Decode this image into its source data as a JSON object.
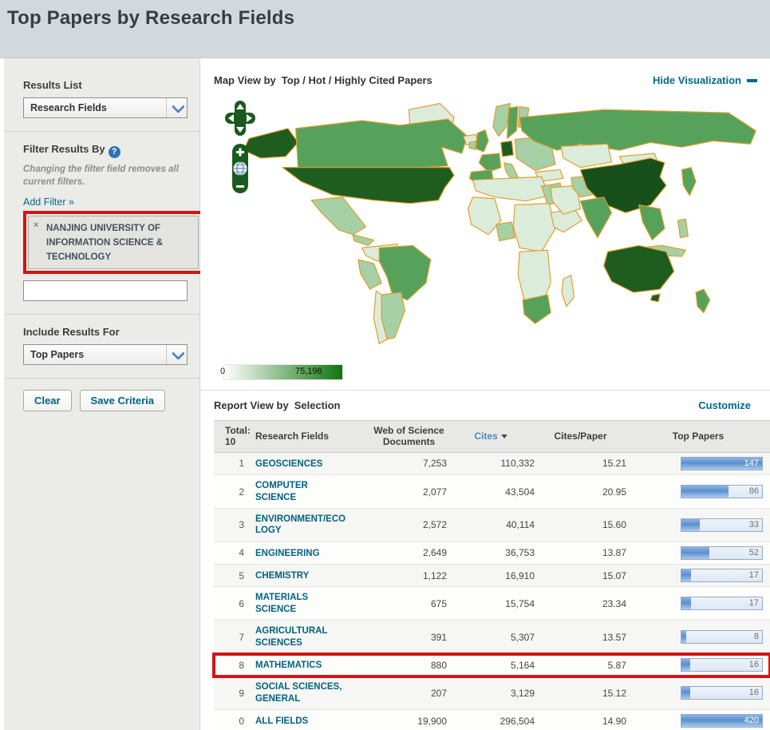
{
  "theme": {
    "header_bg": "#d2d9dd",
    "teal_link": "#00698c",
    "field_link": "#00637f",
    "sort_blue": "#4d86c4",
    "annotation_red": "#d21414"
  },
  "page": {
    "title": "Top Papers by Research Fields"
  },
  "sidebar": {
    "results_list": {
      "label": "Results List",
      "value": "Research Fields"
    },
    "filter": {
      "label": "Filter Results By",
      "note": "Changing the filter field removes all current filters.",
      "add_filter_link": "Add Filter »",
      "chip": {
        "remove": "×",
        "text": "NANJING UNIVERSITY OF INFORMATION SCIENCE & TECHNOLOGY"
      },
      "input_value": ""
    },
    "include_results": {
      "label": "Include Results For",
      "value": "Top Papers"
    },
    "buttons": {
      "clear": "Clear",
      "save": "Save Criteria"
    }
  },
  "map_section": {
    "title_prefix": "Map View by",
    "title": "Top / Hot / Highly Cited Papers",
    "hide_link": "Hide Visualization",
    "legend": {
      "min": "0",
      "max": "75,196"
    },
    "colors": {
      "dark": "#1e5c20",
      "darker": "#17501a",
      "medium": "#57a25b",
      "light": "#a6d0a6",
      "pale": "#dcecdb",
      "border": "#e29c2a",
      "legend_end": "#0f750f",
      "controls": "#1a5a1e"
    },
    "regions": [
      {
        "name": "alaska",
        "tone": "dark"
      },
      {
        "name": "canada",
        "tone": "medium"
      },
      {
        "name": "greenland",
        "tone": "pale"
      },
      {
        "name": "usa",
        "tone": "dark"
      },
      {
        "name": "mexico",
        "tone": "light"
      },
      {
        "name": "central-america",
        "tone": "light"
      },
      {
        "name": "colombia-venezuela",
        "tone": "pale"
      },
      {
        "name": "peru",
        "tone": "light"
      },
      {
        "name": "brazil",
        "tone": "medium"
      },
      {
        "name": "argentina",
        "tone": "light"
      },
      {
        "name": "chile",
        "tone": "pale"
      },
      {
        "name": "iceland",
        "tone": "pale"
      },
      {
        "name": "uk",
        "tone": "medium"
      },
      {
        "name": "ireland",
        "tone": "light"
      },
      {
        "name": "norway",
        "tone": "light"
      },
      {
        "name": "sweden",
        "tone": "medium"
      },
      {
        "name": "finland",
        "tone": "light"
      },
      {
        "name": "spain",
        "tone": "medium"
      },
      {
        "name": "france",
        "tone": "medium"
      },
      {
        "name": "germany",
        "tone": "dark"
      },
      {
        "name": "italy",
        "tone": "light"
      },
      {
        "name": "eastern-europe",
        "tone": "light"
      },
      {
        "name": "turkey",
        "tone": "pale"
      },
      {
        "name": "north-africa",
        "tone": "pale"
      },
      {
        "name": "egypt",
        "tone": "light"
      },
      {
        "name": "west-africa",
        "tone": "pale"
      },
      {
        "name": "nigeria",
        "tone": "light"
      },
      {
        "name": "central-africa",
        "tone": "pale"
      },
      {
        "name": "east-africa",
        "tone": "pale"
      },
      {
        "name": "southern-africa",
        "tone": "pale"
      },
      {
        "name": "south-africa",
        "tone": "medium"
      },
      {
        "name": "madagascar",
        "tone": "pale"
      },
      {
        "name": "saudi-arabia",
        "tone": "pale"
      },
      {
        "name": "iran",
        "tone": "light"
      },
      {
        "name": "russia",
        "tone": "medium"
      },
      {
        "name": "kazakhstan",
        "tone": "pale"
      },
      {
        "name": "mongolia",
        "tone": "pale"
      },
      {
        "name": "china",
        "tone": "darker"
      },
      {
        "name": "india",
        "tone": "medium"
      },
      {
        "name": "southeast-asia",
        "tone": "medium"
      },
      {
        "name": "indonesia",
        "tone": "light"
      },
      {
        "name": "philippines",
        "tone": "light"
      },
      {
        "name": "japan",
        "tone": "medium"
      },
      {
        "name": "australia",
        "tone": "dark"
      },
      {
        "name": "tasmania",
        "tone": "dark"
      },
      {
        "name": "new-zealand",
        "tone": "medium"
      }
    ]
  },
  "report_section": {
    "title_prefix": "Report View by",
    "title": "Selection",
    "customize_link": "Customize",
    "table": {
      "total_label": "Total:",
      "total_value": "10",
      "columns": {
        "fields": "Research Fields",
        "docs": "Web of Science Documents",
        "cites": "Cites",
        "cites_per_paper": "Cites/Paper",
        "top_papers": "Top Papers"
      },
      "sorted_by": "Cites",
      "rows": [
        {
          "rank": "1",
          "field": "GEOSCIENCES",
          "docs": "7,253",
          "cites": "110,332",
          "cites_per_paper": "15.21",
          "top_papers": "147",
          "bar_pct": 100,
          "bar_full": true,
          "highlighted": false
        },
        {
          "rank": "2",
          "field": "COMPUTER SCIENCE",
          "docs": "2,077",
          "cites": "43,504",
          "cites_per_paper": "20.95",
          "top_papers": "86",
          "bar_pct": 58,
          "bar_full": false,
          "highlighted": false
        },
        {
          "rank": "3",
          "field": "ENVIRONMENT/ECOLOGY",
          "docs": "2,572",
          "cites": "40,114",
          "cites_per_paper": "15.60",
          "top_papers": "33",
          "bar_pct": 23,
          "bar_full": false,
          "highlighted": false
        },
        {
          "rank": "4",
          "field": "ENGINEERING",
          "docs": "2,649",
          "cites": "36,753",
          "cites_per_paper": "13.87",
          "top_papers": "52",
          "bar_pct": 35,
          "bar_full": false,
          "highlighted": false
        },
        {
          "rank": "5",
          "field": "CHEMISTRY",
          "docs": "1,122",
          "cites": "16,910",
          "cites_per_paper": "15.07",
          "top_papers": "17",
          "bar_pct": 12,
          "bar_full": false,
          "highlighted": false
        },
        {
          "rank": "6",
          "field": "MATERIALS SCIENCE",
          "docs": "675",
          "cites": "15,754",
          "cites_per_paper": "23.34",
          "top_papers": "17",
          "bar_pct": 12,
          "bar_full": false,
          "highlighted": false
        },
        {
          "rank": "7",
          "field": "AGRICULTURAL SCIENCES",
          "docs": "391",
          "cites": "5,307",
          "cites_per_paper": "13.57",
          "top_papers": "8",
          "bar_pct": 6,
          "bar_full": false,
          "highlighted": false
        },
        {
          "rank": "8",
          "field": "MATHEMATICS",
          "docs": "880",
          "cites": "5,164",
          "cites_per_paper": "5.87",
          "top_papers": "16",
          "bar_pct": 11,
          "bar_full": false,
          "highlighted": true
        },
        {
          "rank": "9",
          "field": "SOCIAL SCIENCES, GENERAL",
          "docs": "207",
          "cites": "3,129",
          "cites_per_paper": "15.12",
          "top_papers": "16",
          "bar_pct": 11,
          "bar_full": false,
          "highlighted": false
        },
        {
          "rank": "0",
          "field": "ALL FIELDS",
          "docs": "19,900",
          "cites": "296,504",
          "cites_per_paper": "14.90",
          "top_papers": "420",
          "bar_pct": 100,
          "bar_full": true,
          "highlighted": false
        }
      ]
    }
  }
}
